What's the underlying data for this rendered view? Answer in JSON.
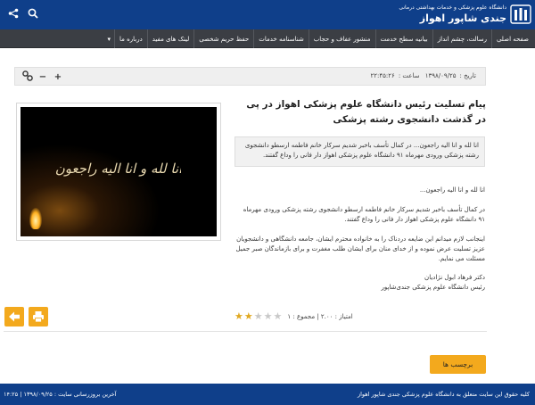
{
  "header": {
    "subtitle": "دانشگاه علوم پزشکی و خدمات بهداشتی درمانی",
    "title": "جندی شاپور اهواز",
    "colors": {
      "primary": "#0f3f8a",
      "nav": "#3b3e44",
      "accent": "#f3a91d"
    },
    "icons": [
      "search-icon",
      "share-icon"
    ]
  },
  "nav": {
    "items": [
      "صفحه اصلی",
      "رسالت، چشم انداز",
      "بیانیه سطح خدمت",
      "منشور عفاف و حجاب",
      "شناسنامه خدمات",
      "حفظ حریم شخصی",
      "لینک های مفید",
      "درباره ما"
    ]
  },
  "toolbar": {
    "date_label": "تاریخ :",
    "date_value": "۱۳۹۸/۰۹/۲۵",
    "time_label": "ساعت :",
    "time_value": "۲۲:۴۵:۲۶"
  },
  "article": {
    "title": "پیام تسلیت رئیس دانشگاه علوم پزشکی اهواز در پی در گذشت دانشجوی رشته پزشکی",
    "image_text": "انا لله و انا الیه راجعون",
    "summary": "انا لله و انا الیه راجعون... در کمال تأسف باخبر شدیم سرکار خانم فاطمه ارسطو دانشجوی رشته پزشکی ورودی مهرماه ۹۱ دانشگاه علوم پزشکی اهواز دار فانی را وداع گفتند.",
    "paragraph1": "انا لله و انا الیه راجعون...",
    "paragraph2": "در کمال تأسف باخبر شدیم سرکار خانم فاطمه ارسطو دانشجوی رشته پزشکی ورودی مهرماه ۹۱ دانشگاه علوم پزشکی اهواز دار فانی را وداع گفتند.",
    "paragraph3": "اینجانب لازم میدانم این ضایعه دردناک را به خانواده محترم ایشان، جامعه دانشگاهی و دانشجویان عزیز تسلیت عرض نموده و از خدای منان برای ایشان طلب مغفرت و برای بازماندگان صبر جمیل مسئلت می نمایم.",
    "signature_name": "دکتر فرهاد ابول نژادیان",
    "signature_role": "رئیس دانشگاه علوم پزشکی جندی‌شاپور"
  },
  "rating": {
    "label": "امتیاز :",
    "score": "۲.۰۰",
    "total_label": "مجموع :",
    "total": "۱",
    "stars_filled": 2,
    "stars_max": 5
  },
  "actions": {
    "tags_label": "برچسب ها"
  },
  "footer": {
    "copyright": "کلیه حقوق این سایت متعلق به دانشگاه علوم پزشکی جندی شاپور اهواز",
    "last_update": "آخرین بروزرسانی سایت : ۱۳۹۸/۰۹/۲۵ | ۱۴:۲۵"
  }
}
